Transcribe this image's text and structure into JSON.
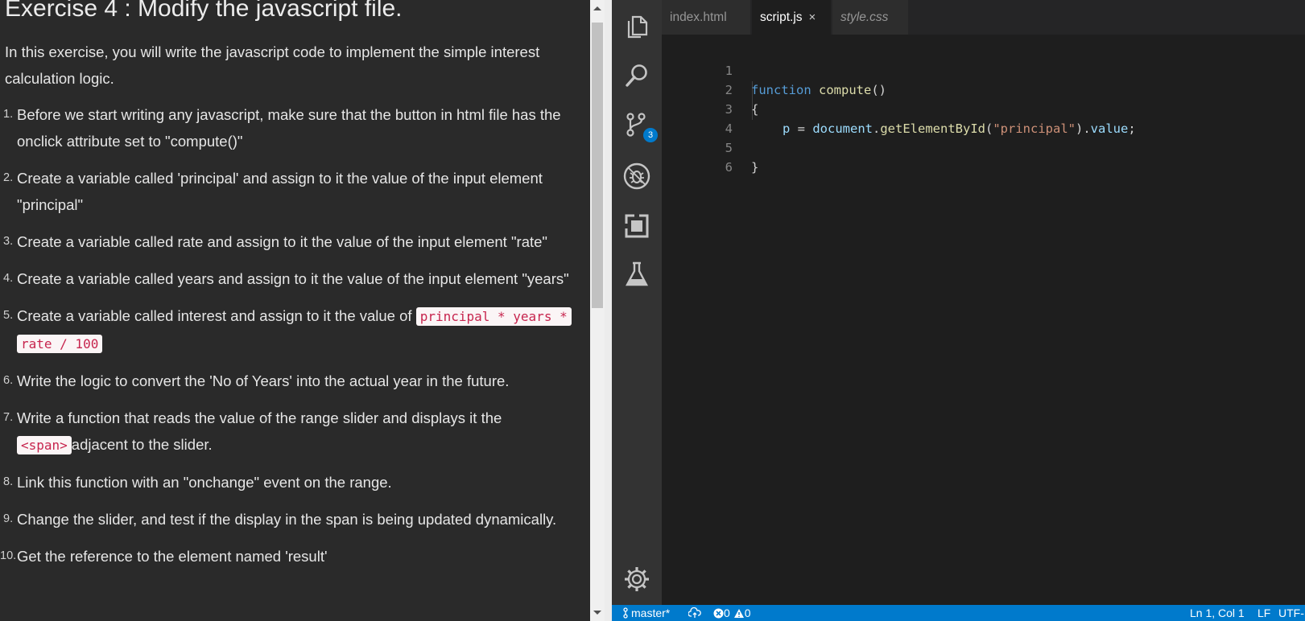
{
  "instructions": {
    "title": "Exercise 4 : Modify the javascript file.",
    "intro": "In this exercise, you will write the javascript code to implement the simple interest calculation logic.",
    "steps": [
      {
        "num": "1.",
        "text": "Before we start writing any javascript, make sure that the button in html file has the onclick attribute set to \"compute()\""
      },
      {
        "num": "2.",
        "text": "Create a variable called 'principal' and assign to it the value of the input element \"principal\""
      },
      {
        "num": "3.",
        "text": "Create a variable called rate and assign to it the value of the input element \"rate\""
      },
      {
        "num": "4.",
        "text": "Create a variable called years and assign to it the value of the input element \"years\""
      },
      {
        "num": "5.",
        "text": "Create a variable called interest and assign to it the value of ",
        "code": "principal * years * rate / 100"
      },
      {
        "num": "6.",
        "text": "Write the logic to convert the 'No of Years' into the actual year in the future."
      },
      {
        "num": "7.",
        "text": "Write a function that reads the value of the range slider and displays it the ",
        "code": "<span>",
        "text_after": "adjacent to the slider."
      },
      {
        "num": "8.",
        "text": "Link this function with an \"onchange\" event on the range."
      },
      {
        "num": "9.",
        "text": "Change the slider, and test if the display in the span is being updated dynamically."
      },
      {
        "num": "10.",
        "text": "Get the reference to the element named 'result'"
      }
    ]
  },
  "editor": {
    "activity_bar": {
      "icons": [
        "files-icon",
        "search-icon",
        "source-control-icon",
        "debug-icon",
        "extensions-icon",
        "test-flask-icon",
        "gear-icon"
      ],
      "scm_badge": "3"
    },
    "tabs": [
      {
        "label": "index.html",
        "active": false
      },
      {
        "label": "script.js",
        "active": true,
        "close": "×"
      },
      {
        "label": "style.css",
        "active": false
      }
    ],
    "code": {
      "line_numbers": [
        "1",
        "2",
        "3",
        "4",
        "5",
        "6"
      ],
      "lines": {
        "l1_kw": "function",
        "l1_fn": "compute",
        "l1_rest": "()",
        "l2": "{",
        "l3_var": "p",
        "l3_eq": " = ",
        "l3_obj": "document",
        "l3_dot": ".",
        "l3_fn": "getElementById",
        "l3_open": "(",
        "l3_str": "\"principal\"",
        "l3_close": ").",
        "l3_prop": "value",
        "l3_end": ";",
        "l5": "}"
      }
    },
    "status_bar": {
      "branch": "master*",
      "sync_icon": "cloud-sync-icon",
      "errors": "0",
      "warnings": "0",
      "position": "Ln 1, Col 1",
      "eol": "LF",
      "encoding": "UTF-"
    },
    "colors": {
      "accent": "#007acc",
      "keyword": "#569cd6",
      "function": "#dcdcaa",
      "string": "#ce9178",
      "variable": "#9cdcfe"
    }
  }
}
